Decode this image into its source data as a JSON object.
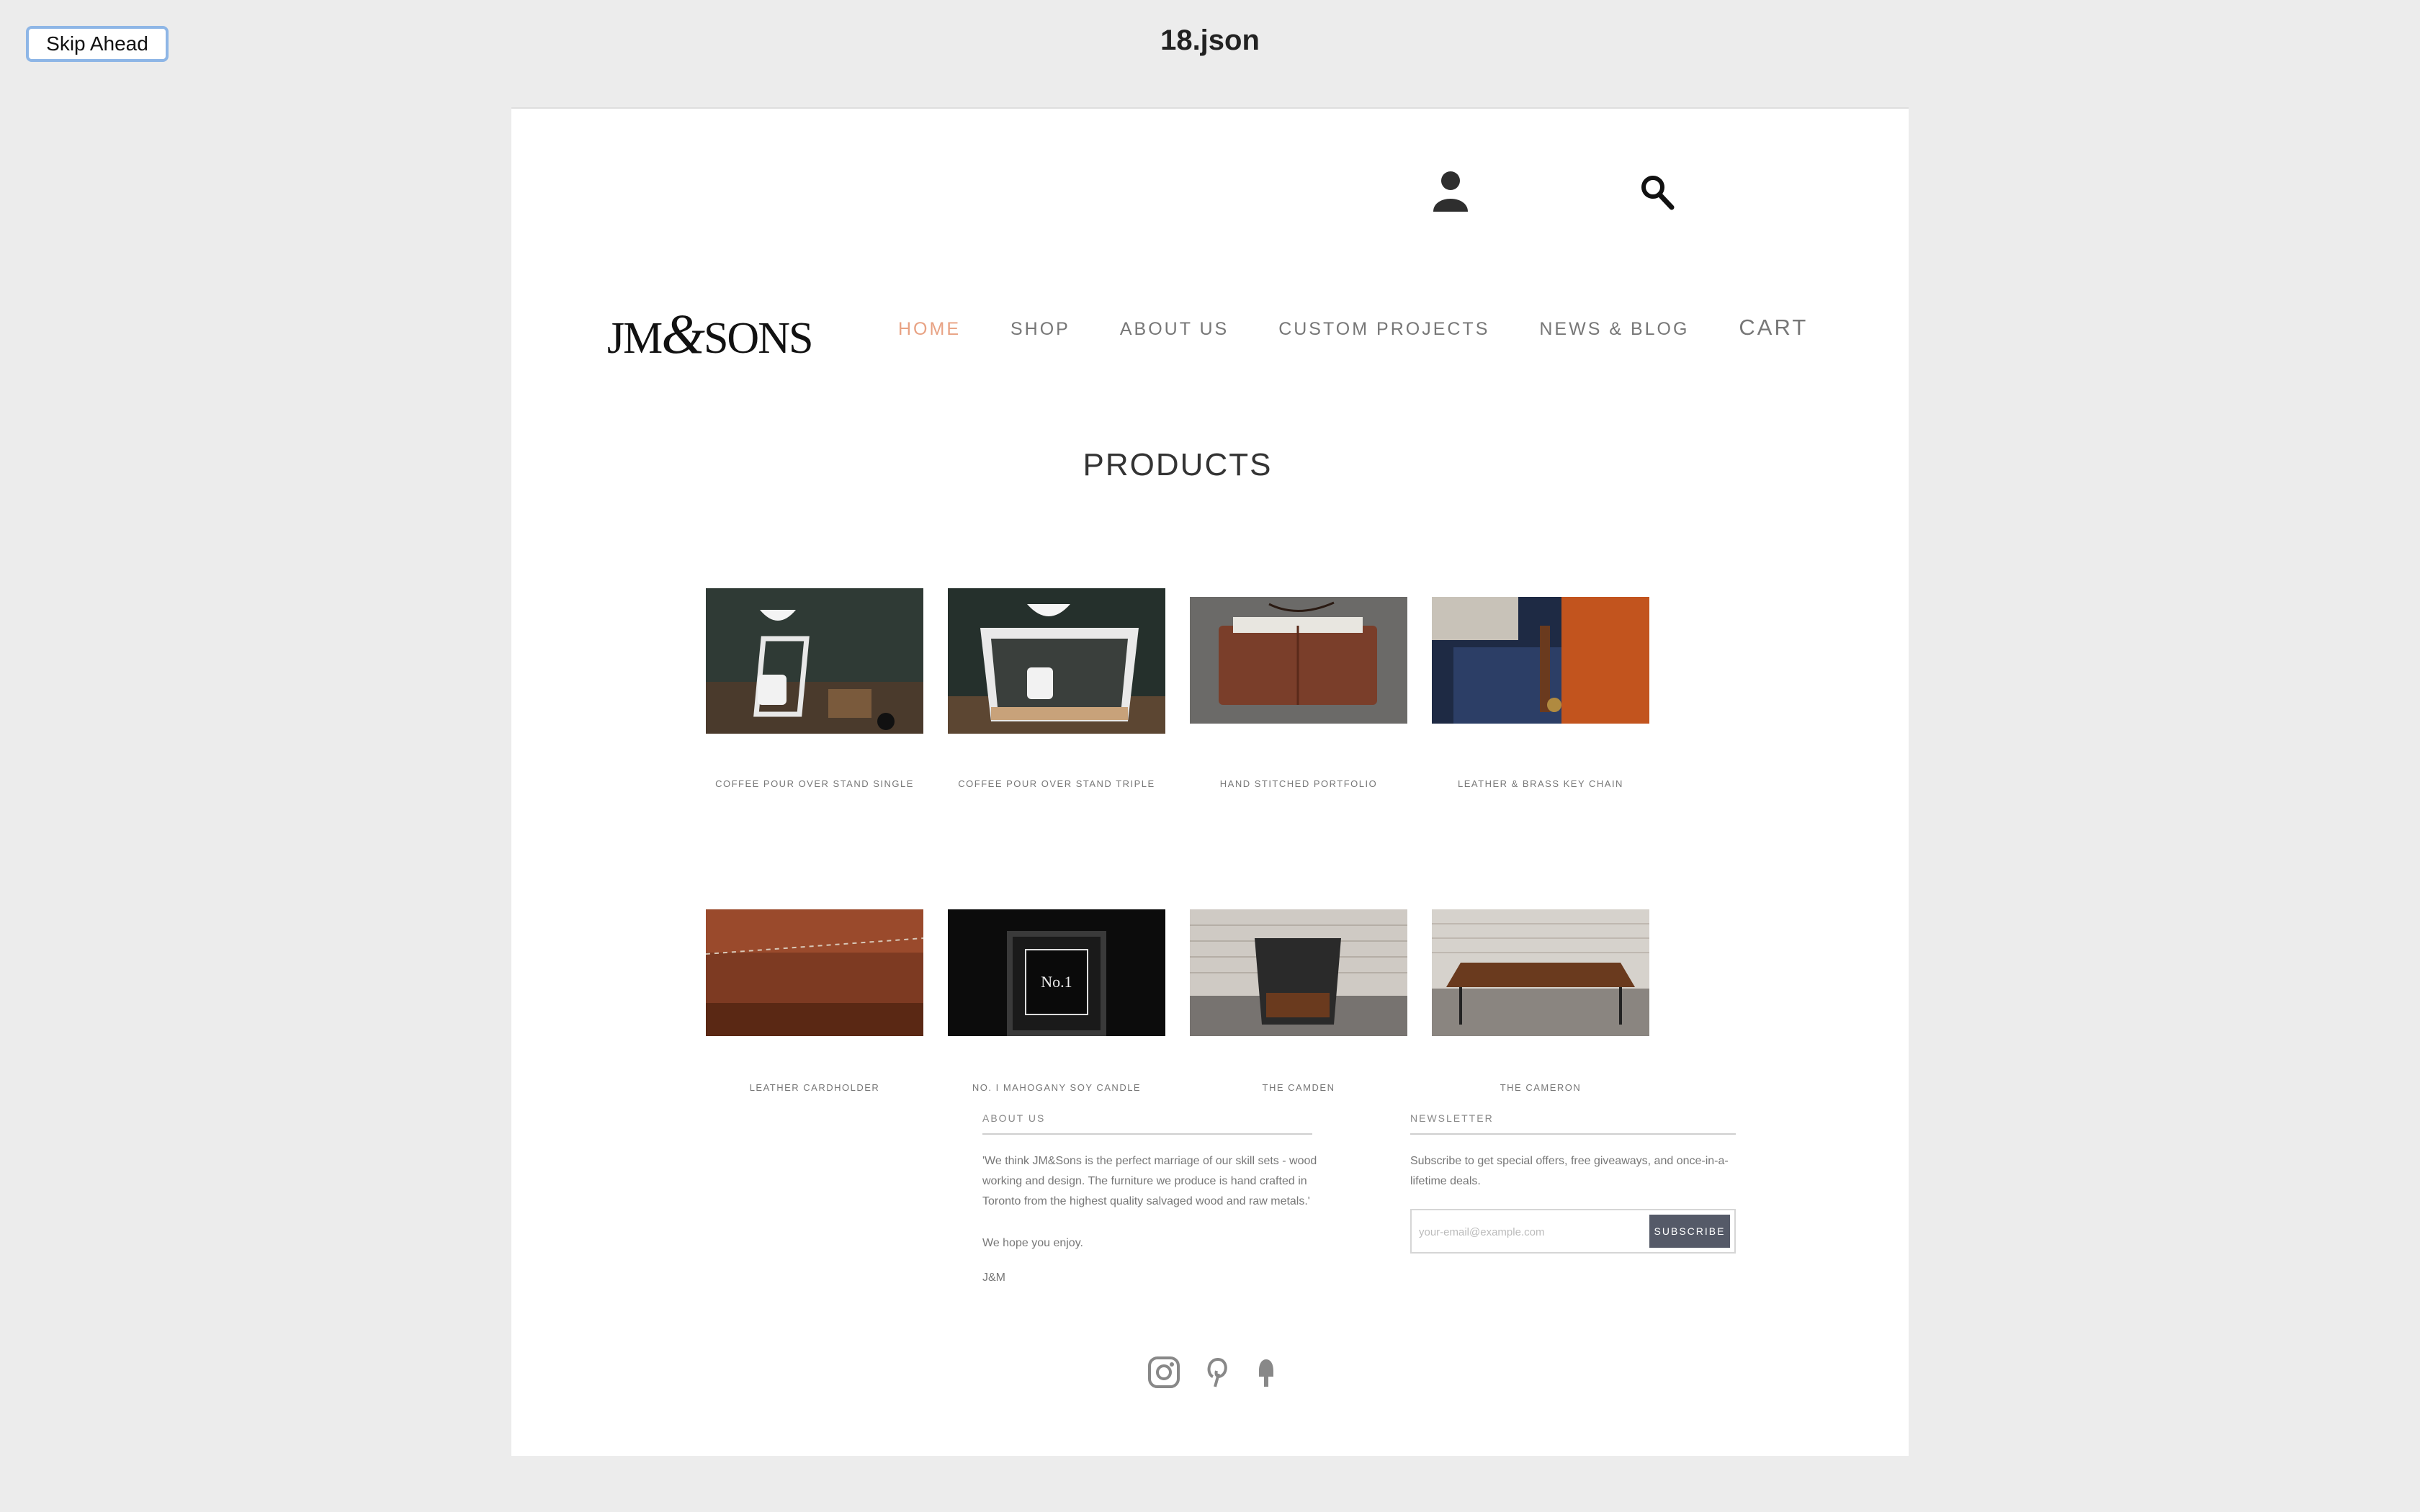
{
  "skip_button": "Skip Ahead",
  "document_title": "18.json",
  "brand": {
    "part1": "JM",
    "amp": "&",
    "part2": "SONS"
  },
  "nav": [
    "HOME",
    "SHOP",
    "ABOUT US",
    "CUSTOM PROJECTS",
    "NEWS & BLOG"
  ],
  "cart_label": "CART",
  "section_title": "PRODUCTS",
  "products": [
    {
      "name": "COFFEE POUR OVER STAND SINGLE"
    },
    {
      "name": "COFFEE POUR OVER STAND TRIPLE"
    },
    {
      "name": "HAND STITCHED PORTFOLIO"
    },
    {
      "name": "LEATHER & BRASS KEY CHAIN"
    },
    {
      "name": "LEATHER CARDHOLDER"
    },
    {
      "name": "NO. I MAHOGANY SOY CANDLE"
    },
    {
      "name": "THE CAMDEN"
    },
    {
      "name": "THE CAMERON"
    }
  ],
  "candle_label": "No.1",
  "footer": {
    "about_heading": "ABOUT US",
    "about_lines": [
      "'We think JM&Sons is the perfect marriage of our skill sets - wood",
      "working and design. The furniture we produce is hand crafted in",
      "Toronto from the highest quality salvaged wood and raw metals.'"
    ],
    "hope_text": "We hope you enjoy.",
    "signature": "J&M",
    "newsletter_heading": "NEWSLETTER",
    "newsletter_lines": [
      "Subscribe to get special offers, free giveaways, and once-in-a-",
      "lifetime deals."
    ],
    "email_placeholder": "your-email@example.com",
    "subscribe_label": "SUBSCRIBE"
  },
  "icons": {
    "user": "user-icon",
    "search": "search-icon",
    "social": [
      "instagram-icon",
      "pinterest-icon",
      "tumblr-icon"
    ]
  },
  "colors": {
    "nav_active": "#e8a283",
    "subscribe_bg": "#555a68",
    "page_bg": "#ececec"
  }
}
